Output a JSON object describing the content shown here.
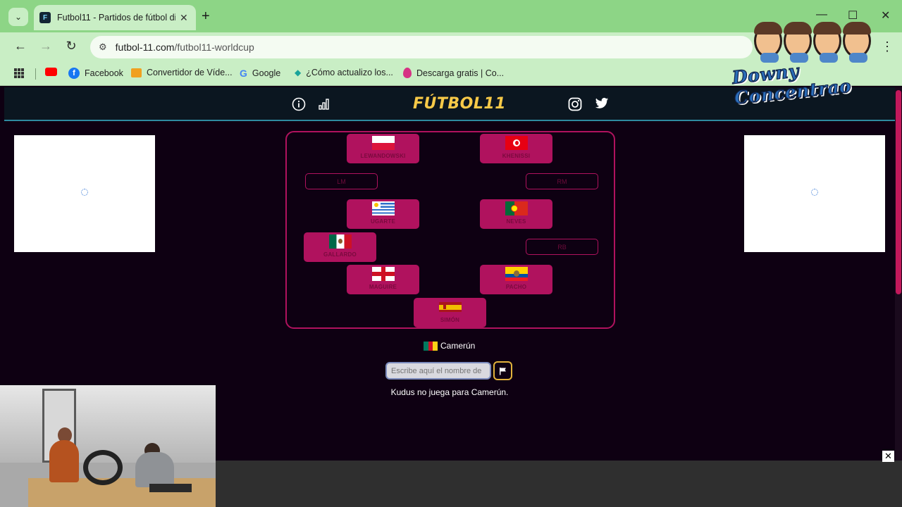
{
  "browser": {
    "tab_title": "Futbol11 - Partidos de fútbol di",
    "url_host": "futbol-11.com",
    "url_path": "/futbol11-worldcup",
    "bookmarks": [
      {
        "label": "Facebook",
        "icon": "facebook-icon"
      },
      {
        "label": "Convertidor de Víde...",
        "icon": "convert-icon"
      },
      {
        "label": "Google",
        "icon": "google-icon"
      },
      {
        "label": "¿Cómo actualizo los...",
        "icon": "diamond-icon"
      },
      {
        "label": "Descarga gratis | Co...",
        "icon": "drop-icon"
      }
    ]
  },
  "site": {
    "logo": "FÚTBOL11",
    "header_icons": [
      "info-icon",
      "stats-icon",
      "instagram-icon",
      "twitter-icon"
    ],
    "field": {
      "players": [
        {
          "name": "LEWANDOWSKI",
          "flag": "poland"
        },
        {
          "name": "KHENISSI",
          "flag": "tunisia"
        },
        {
          "name": "UGARTE",
          "flag": "uruguay"
        },
        {
          "name": "NEVES",
          "flag": "portugal"
        },
        {
          "name": "GALLARDO",
          "flag": "mexico"
        },
        {
          "name": "MAGUIRE",
          "flag": "england"
        },
        {
          "name": "PACHO",
          "flag": "ecuador"
        },
        {
          "name": "SIMÓN",
          "flag": "spain"
        }
      ],
      "empty_slots": [
        "LM",
        "RM",
        "RB"
      ]
    },
    "current_country": "Camerún",
    "search_placeholder": "Escribe aquí el nombre de",
    "message": "Kudus no juega para Camerún."
  },
  "overlay": {
    "text": "Downy Concentrao"
  },
  "colors": {
    "card": "#b0125e",
    "logo": "#f7c948",
    "background": "#0e0012"
  }
}
